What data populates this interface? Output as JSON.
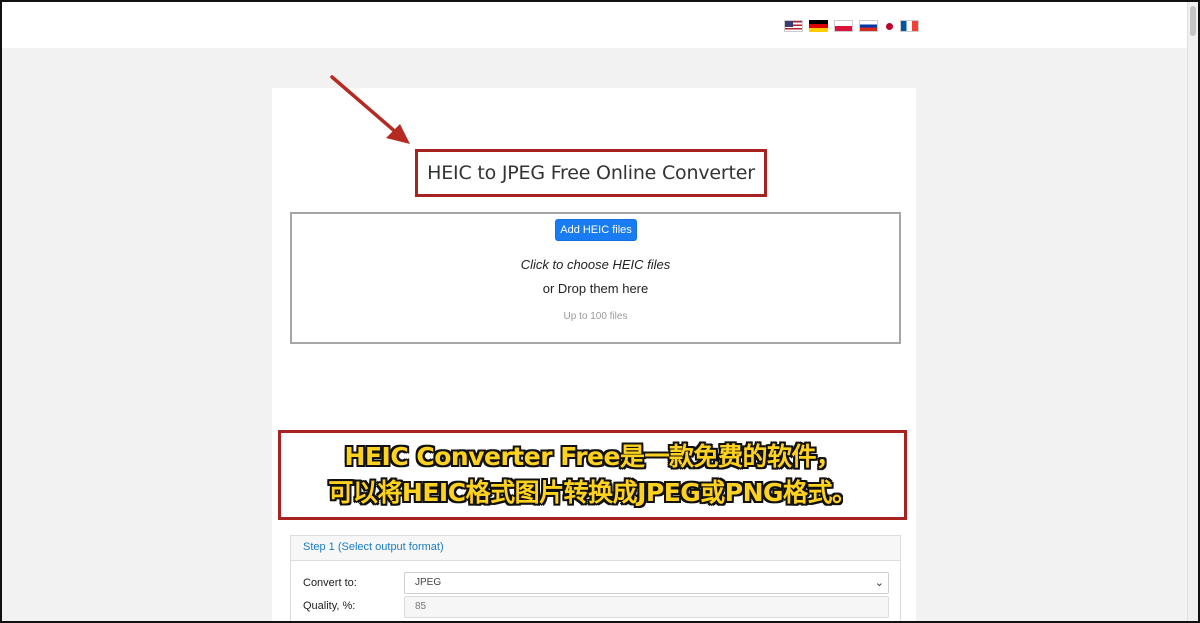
{
  "header": {
    "languages": [
      {
        "name": "us-flag-icon",
        "colors": [
          "#b22234",
          "#ffffff",
          "#3c3b6e"
        ]
      },
      {
        "name": "de-flag-icon",
        "colors": [
          "#000000",
          "#dd0000",
          "#ffce00"
        ]
      },
      {
        "name": "pl-flag-icon",
        "colors": [
          "#ffffff",
          "#dc143c"
        ]
      },
      {
        "name": "ru-flag-icon",
        "colors": [
          "#ffffff",
          "#0039a6",
          "#d52b1e"
        ]
      },
      {
        "name": "jp-flag-icon",
        "colors": [
          "#bc002d"
        ]
      },
      {
        "name": "fr-flag-icon",
        "colors": [
          "#0055a4",
          "#ffffff",
          "#ef4135"
        ]
      }
    ]
  },
  "main": {
    "title": "HEIC to JPEG Free Online Converter",
    "highlight_color": "#a8231f",
    "arrow_icon": "red-arrow-icon"
  },
  "dropzone": {
    "button_label": "Add HEIC files",
    "line1": "Click to choose HEIC files",
    "line2": "or Drop them here",
    "limit": "Up to 100 files",
    "button_color": "#1a7cf3"
  },
  "caption": {
    "line1": "HEIC Converter Free是一款免费的软件，",
    "line2": "可以将HEIC格式图片转换成JPEG或PNG格式。",
    "text_color": "#ffd21f"
  },
  "step1": {
    "title": "Step 1 (Select output format)",
    "convert_label": "Convert to:",
    "convert_value": "JPEG",
    "quality_label": "Quality, %:",
    "quality_value": "85"
  }
}
